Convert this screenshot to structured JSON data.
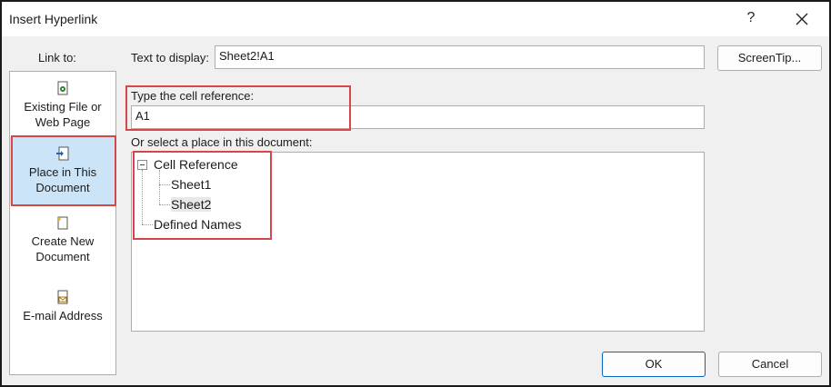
{
  "window": {
    "title": "Insert Hyperlink",
    "help_glyph": "?",
    "close_icon": "close-icon"
  },
  "link_to": {
    "label": "Link to:",
    "items": [
      {
        "line1": "Existing File or",
        "line2": "Web Page",
        "icon": "existing-file-icon",
        "selected": false
      },
      {
        "line1": "Place in This",
        "line2": "Document",
        "icon": "place-in-document-icon",
        "selected": true
      },
      {
        "line1": "Create New",
        "line2": "Document",
        "icon": "new-document-icon",
        "selected": false
      },
      {
        "line1": "E-mail Address",
        "line2": "",
        "icon": "email-icon",
        "selected": false
      }
    ]
  },
  "text_to_display": {
    "label": "Text to display:",
    "value": "Sheet2!A1"
  },
  "screentip_label": "ScreenTip...",
  "cell_reference": {
    "label": "Type the cell reference:",
    "value": "A1"
  },
  "place_select": {
    "label": "Or select a place in this document:",
    "tree": {
      "root": "Cell Reference",
      "children": [
        "Sheet1",
        "Sheet2"
      ],
      "selected": "Sheet2",
      "sibling": "Defined Names"
    }
  },
  "buttons": {
    "ok": "OK",
    "cancel": "Cancel"
  },
  "colors": {
    "highlight": "#d6464a",
    "selected_nav": "#cce4f7",
    "ok_border": "#0067c0"
  }
}
